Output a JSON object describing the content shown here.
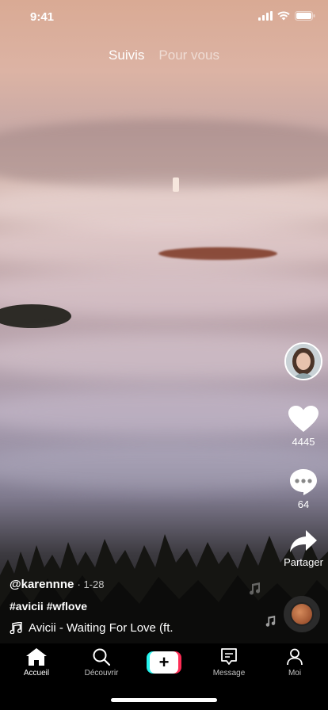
{
  "status": {
    "time": "9:41"
  },
  "tabs": {
    "following": "Suivis",
    "for_you": "Pour vous"
  },
  "rail": {
    "likes": "4445",
    "comments": "64",
    "share": "Partager"
  },
  "caption": {
    "username": "@karennne",
    "date": "· 1-28",
    "tags": "#avicii #wflove",
    "song": "Avicii - Waiting For Love (ft."
  },
  "nav": [
    {
      "label": "Accueil",
      "icon": "home-icon"
    },
    {
      "label": "Découvrir",
      "icon": "search-icon"
    },
    {
      "label": "",
      "icon": "plus-icon"
    },
    {
      "label": "Message",
      "icon": "message-icon"
    },
    {
      "label": "Moi",
      "icon": "profile-icon"
    }
  ]
}
